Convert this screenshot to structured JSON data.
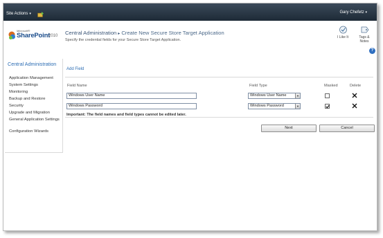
{
  "ribbon": {
    "site_actions": "Site Actions",
    "user_name": "Gary Chefetz"
  },
  "header": {
    "logo_microsoft": "Microsoft®",
    "logo_product": "SharePoint",
    "logo_year": "2010",
    "breadcrumb_root": "Central Administration",
    "breadcrumb_current": "Create New Secure Store Target Application",
    "subtitle": "Specify the credential fields for your Secure Store Target Application.",
    "i_like_it": "I Like It",
    "tags_notes_1": "Tags &",
    "tags_notes_2": "Notes"
  },
  "sidebar": {
    "heading": "Central Administration",
    "items": [
      {
        "label": "Application Management"
      },
      {
        "label": "System Settings"
      },
      {
        "label": "Monitoring"
      },
      {
        "label": "Backup and Restore"
      },
      {
        "label": "Security"
      },
      {
        "label": "Upgrade and Migration"
      },
      {
        "label": "General Application Settings"
      },
      {
        "label": "Configuration Wizards"
      }
    ]
  },
  "main": {
    "add_field": "Add Field",
    "columns": {
      "field_name": "Field Name",
      "field_type": "Field Type",
      "masked": "Masked",
      "delete": "Delete"
    },
    "rows": [
      {
        "name": "Windows User Name",
        "type": "Windows User Name",
        "masked": false
      },
      {
        "name": "Windows Password",
        "type": "Windows Password",
        "masked": true
      }
    ],
    "important": "Important: The field names and field types cannot be edited later.",
    "next_button": "Next",
    "cancel_button": "Cancel"
  },
  "colors": {
    "ribbon_bg": "#1d2a36",
    "link_blue": "#2b6cb3",
    "help_blue": "#2f6fc0"
  },
  "icons": [
    "navigate-up-icon",
    "sharepoint-logo-icon",
    "i-like-it-icon",
    "tags-notes-icon",
    "help-icon",
    "delete-x-icon",
    "checkbox-icon",
    "dropdown-arrow-icon"
  ]
}
